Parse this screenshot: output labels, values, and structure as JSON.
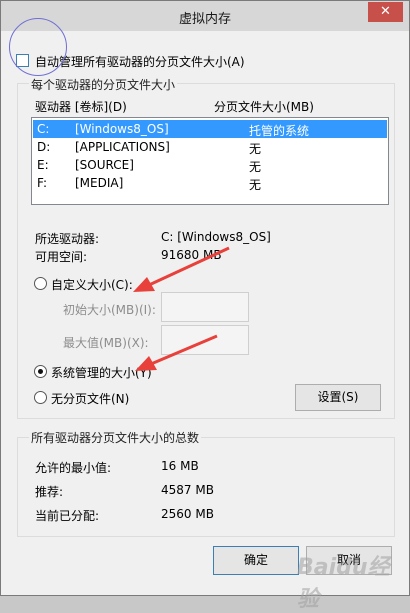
{
  "window": {
    "title": "虚拟内存",
    "close_glyph": "✕"
  },
  "auto_manage": {
    "label": "自动管理所有驱动器的分页文件大小(A)",
    "checked": false
  },
  "per_drive": {
    "legend": "每个驱动器的分页文件大小",
    "col_drive": "驱动器 [卷标](D)",
    "col_size": "分页文件大小(MB)",
    "rows": [
      {
        "drive": "C:",
        "label": "[Windows8_OS]",
        "size": "托管的系统",
        "selected": true
      },
      {
        "drive": "D:",
        "label": "[APPLICATIONS]",
        "size": "无",
        "selected": false
      },
      {
        "drive": "E:",
        "label": "[SOURCE]",
        "size": "无",
        "selected": false
      },
      {
        "drive": "F:",
        "label": "[MEDIA]",
        "size": "无",
        "selected": false
      }
    ],
    "selected_drive_label": "所选驱动器:",
    "selected_drive_value": "C:  [Windows8_OS]",
    "free_space_label": "可用空间:",
    "free_space_value": "91680 MB",
    "custom_size": {
      "label": "自定义大小(C):",
      "checked": false
    },
    "initial_size_label": "初始大小(MB)(I):",
    "max_size_label": "最大值(MB)(X):",
    "system_managed": {
      "label": "系统管理的大小(Y)",
      "checked": true
    },
    "no_paging": {
      "label": "无分页文件(N)",
      "checked": false
    },
    "set_button": "设置(S)"
  },
  "totals": {
    "legend": "所有驱动器分页文件大小的总数",
    "min_label": "允许的最小值:",
    "min_value": "16 MB",
    "recommended_label": "推荐:",
    "recommended_value": "4587 MB",
    "current_label": "当前已分配:",
    "current_value": "2560 MB"
  },
  "buttons": {
    "ok": "确定",
    "cancel": "取消"
  },
  "watermark": "Baidu经验",
  "colors": {
    "selection": "#3399ff",
    "annotation_arrow": "#e8403a",
    "close_button": "#c7504b"
  }
}
